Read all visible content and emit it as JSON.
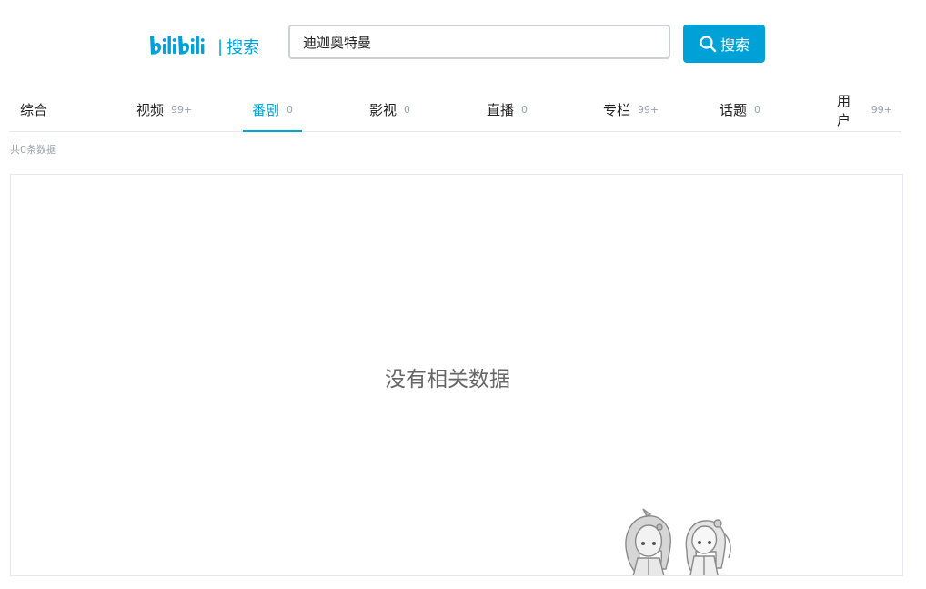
{
  "header": {
    "logo_wordmark": "bilibili",
    "logo_separator": "|",
    "logo_label": "搜索",
    "search_value": "迪迦奥特曼",
    "search_button_label": "搜索",
    "search_icon": "search-icon"
  },
  "tabs": [
    {
      "label": "综合",
      "count": ""
    },
    {
      "label": "视频",
      "count": "99+"
    },
    {
      "label": "番剧",
      "count": "0",
      "active": true
    },
    {
      "label": "影视",
      "count": "0"
    },
    {
      "label": "直播",
      "count": "0"
    },
    {
      "label": "专栏",
      "count": "99+"
    },
    {
      "label": "话题",
      "count": "0"
    },
    {
      "label": "用户",
      "count": "99+"
    }
  ],
  "result_count": "共0条数据",
  "empty_state": {
    "message": "没有相关数据",
    "illustration": "mascots-illustration"
  },
  "colors": {
    "accent": "#00a1d6",
    "muted": "#99a2aa",
    "border": "#e5e9ef"
  }
}
